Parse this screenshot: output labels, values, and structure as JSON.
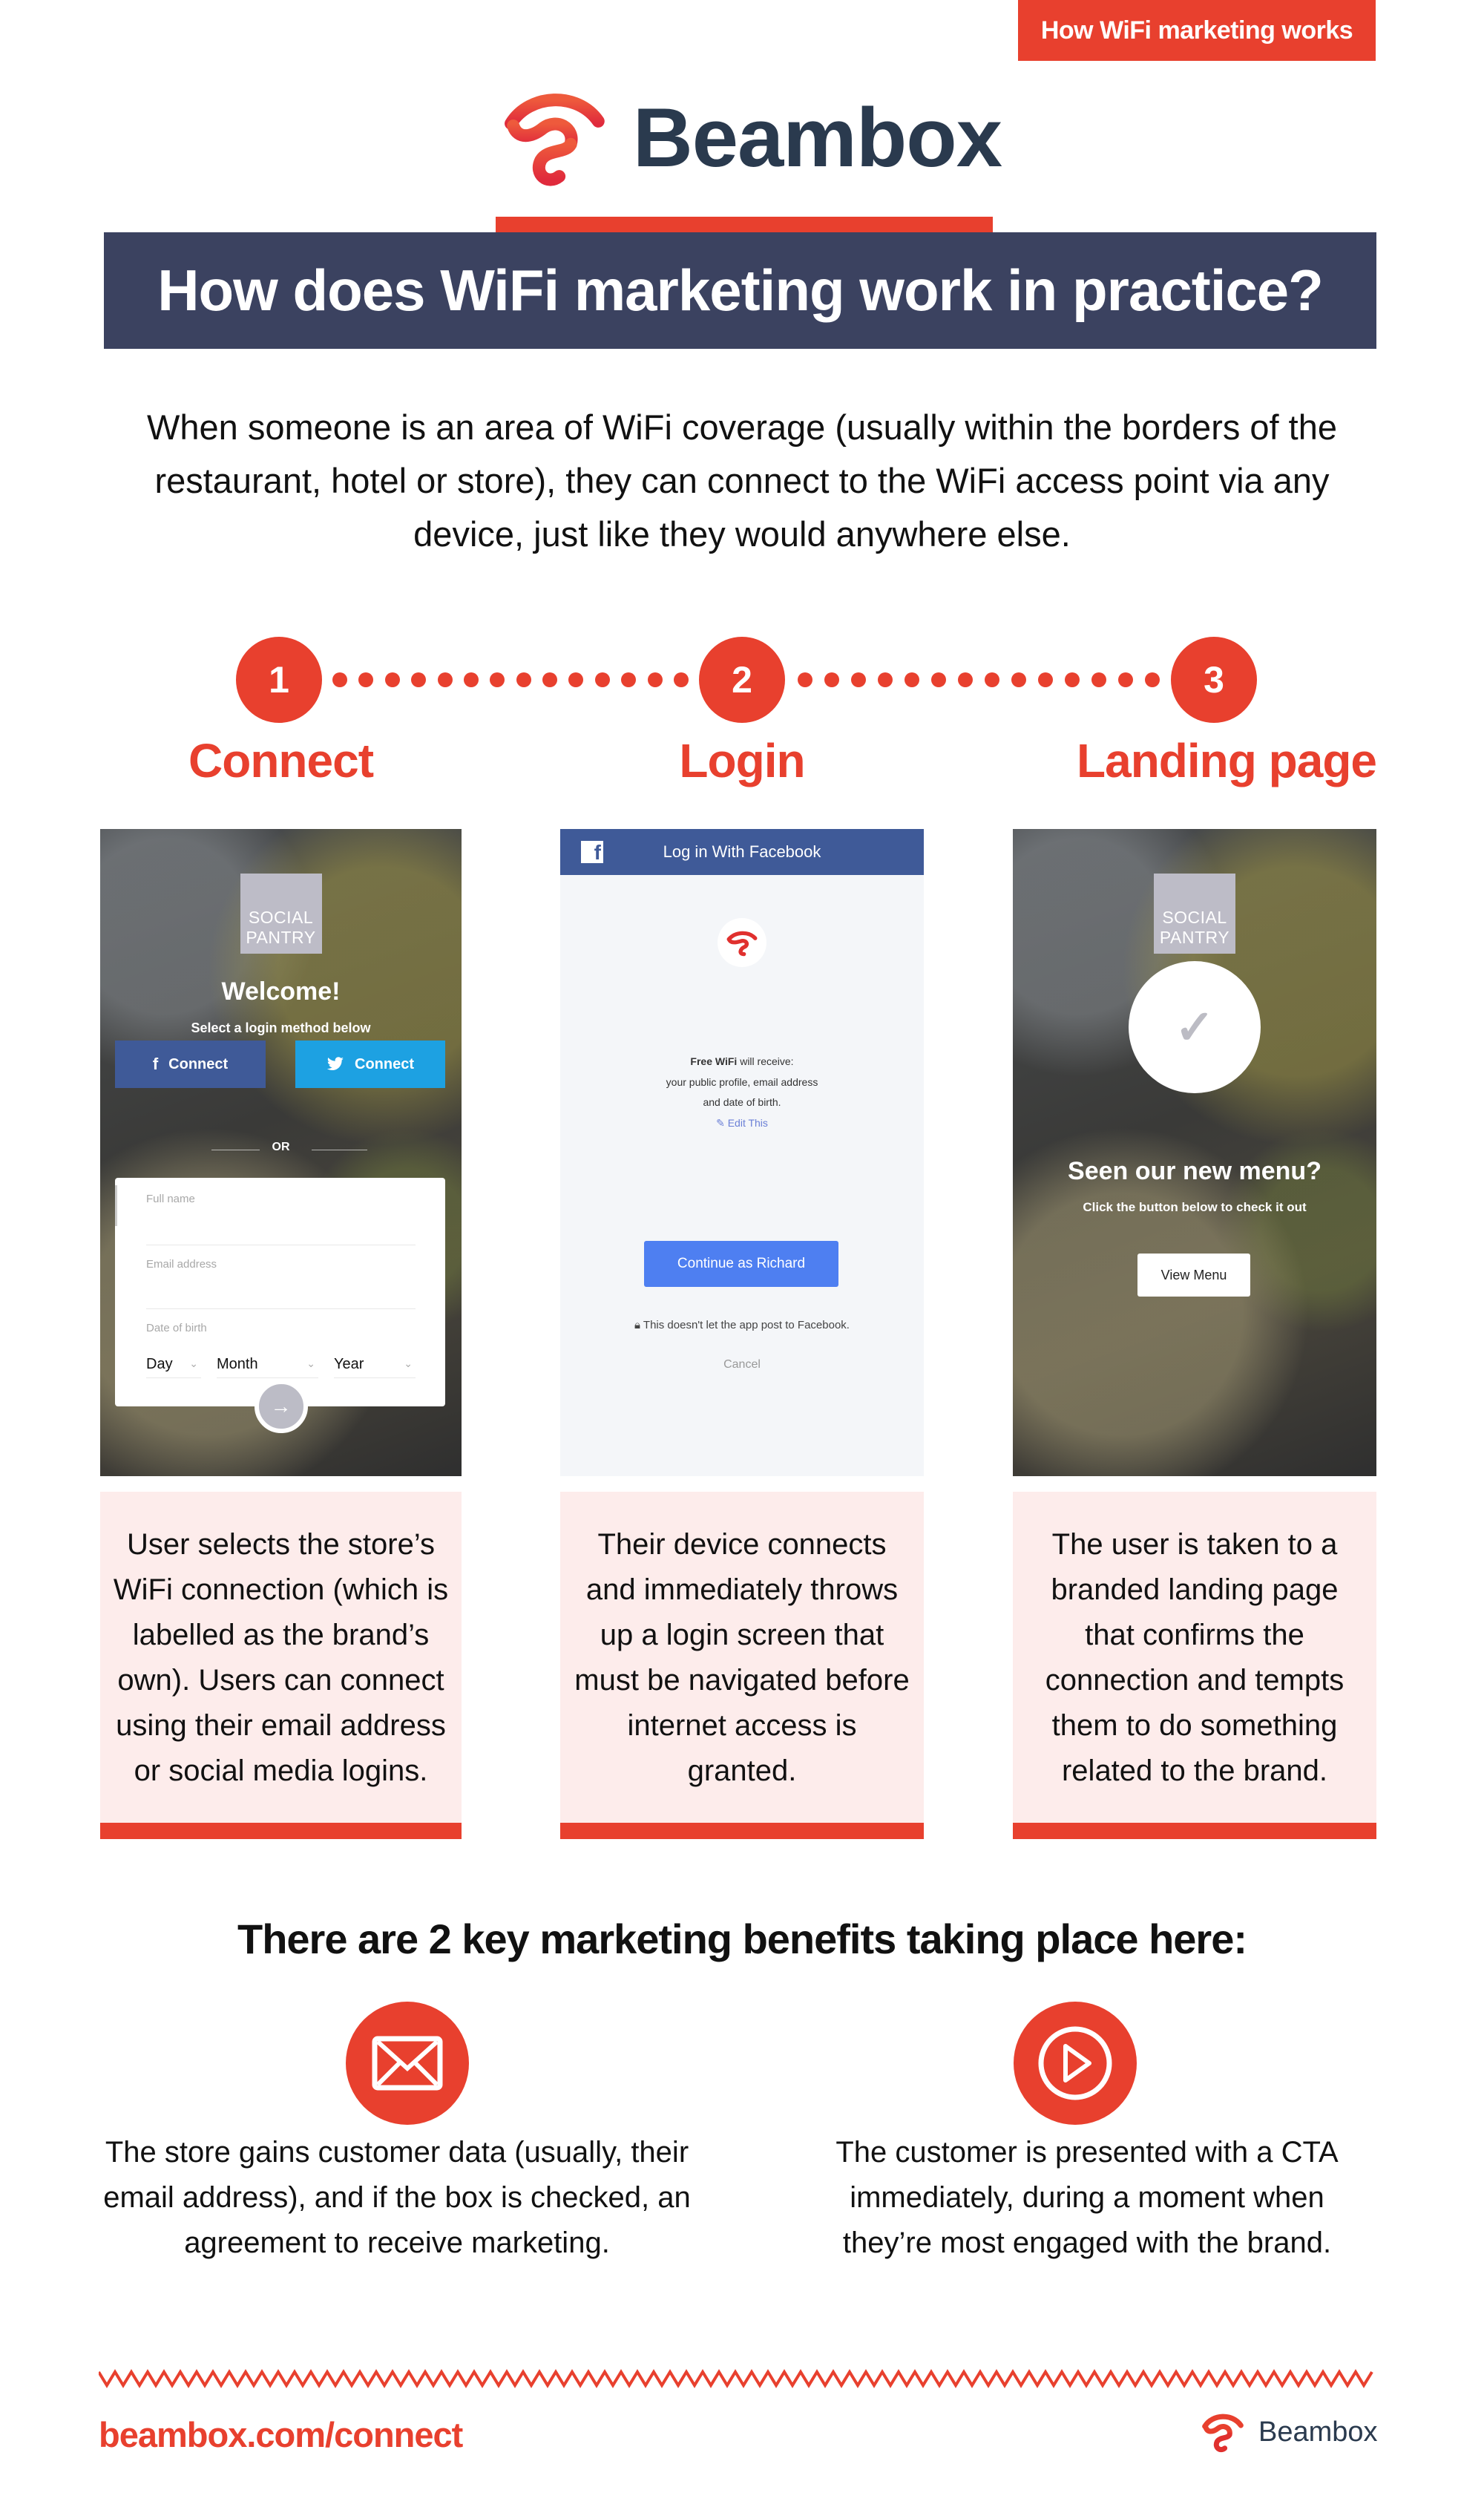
{
  "header": {
    "tag": "How WiFi marketing works",
    "brand": "Beambox",
    "title": "How does WiFi marketing work in practice?",
    "intro": "When someone is an area of WiFi coverage (usually within the borders of the restaurant, hotel or store), they can connect to the WiFi access point via any device, just like they would anywhere else."
  },
  "steps": [
    {
      "number": "1",
      "label": "Connect",
      "description": "User selects the store’s WiFi connection (which is labelled as the brand’s own). Users can connect using their email address or social media logins."
    },
    {
      "number": "2",
      "label": "Login",
      "description": "Their device connects and immediately throws up a login screen that must be navigated before internet access is granted."
    },
    {
      "number": "3",
      "label": "Landing page",
      "description": "The user is taken to a branded landing page that confirms the connection and tempts them to do something related to the brand."
    }
  ],
  "connect_screen": {
    "venue_logo_line1": "SOCIAL",
    "venue_logo_line2": "PANTRY",
    "welcome": "Welcome!",
    "subtitle": "Select a login method below",
    "facebook_button": "Connect",
    "twitter_button": "Connect",
    "or_label": "OR",
    "full_name_label": "Full name",
    "email_label": "Email address",
    "dob_label": "Date of birth",
    "day_select": "Day",
    "month_select": "Month",
    "year_select": "Year",
    "colors": {
      "facebook": "#3f5a98",
      "twitter": "#1da1e2"
    }
  },
  "login_screen": {
    "header": "Log in With Facebook",
    "permission_app": "Free WiFi",
    "permission_line1": " will receive:",
    "permission_line2": "your public profile, email address",
    "permission_line3": "and date of birth.",
    "edit_link": "Edit This",
    "continue_button": "Continue as Richard",
    "note": "This doesn't let the app post to Facebook.",
    "cancel": "Cancel"
  },
  "landing_screen": {
    "venue_logo_line1": "SOCIAL",
    "venue_logo_line2": "PANTRY",
    "headline": "Seen our new menu?",
    "subtitle": "Click the button below to check it out",
    "cta_button": "View Menu"
  },
  "benefits": {
    "title": "There are 2 key marketing benefits taking place here:",
    "items": [
      {
        "icon": "envelope-icon",
        "text": "The store gains customer data (usually, their email address), and if the box is checked, an agreement to receive marketing."
      },
      {
        "icon": "play-icon",
        "text": "The customer is presented with a CTA immediately, during a moment when they’re most engaged with the brand."
      }
    ]
  },
  "footer": {
    "url": "beambox.com/connect",
    "brand": "Beambox"
  },
  "colors": {
    "accent": "#e8402e",
    "navy": "#3b4260",
    "brand_text": "#2a3a4e",
    "desc_bg": "#fdeceb"
  }
}
